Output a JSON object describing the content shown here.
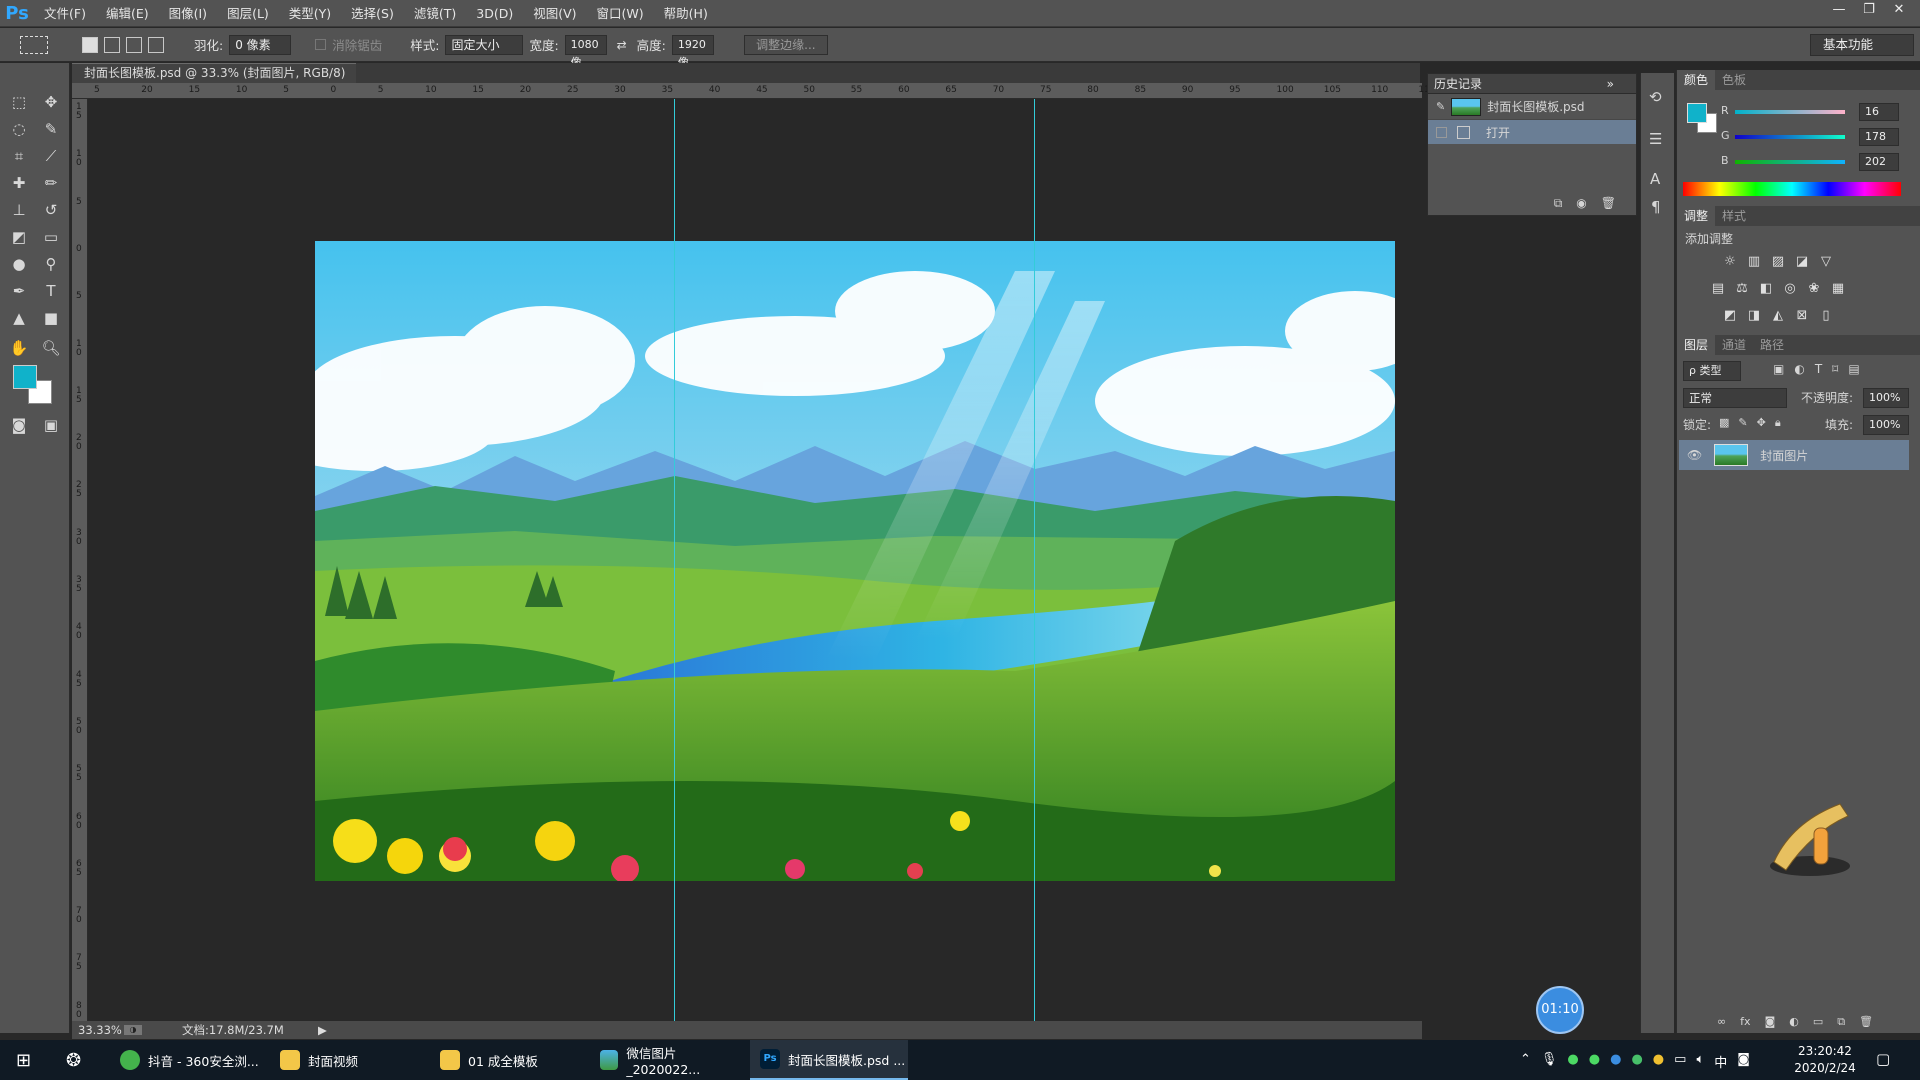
{
  "app": {
    "logo": "Ps"
  },
  "menu": [
    "文件(F)",
    "编辑(E)",
    "图像(I)",
    "图层(L)",
    "类型(Y)",
    "选择(S)",
    "滤镜(T)",
    "3D(D)",
    "视图(V)",
    "窗口(W)",
    "帮助(H)"
  ],
  "window_controls": {
    "minimize": "—",
    "restore": "❐",
    "close": "✕"
  },
  "options": {
    "feather_label": "羽化:",
    "feather_value": "0 像素",
    "antialias_label": "消除锯齿",
    "style_label": "样式:",
    "style_value": "固定大小",
    "width_label": "宽度:",
    "width_value": "1080 像",
    "height_label": "高度:",
    "height_value": "1920 像",
    "refine_edge": "调整边缘...",
    "workspace": "基本功能"
  },
  "document": {
    "tab_title": "封面长图模板.psd @ 33.3% (封面图片, RGB/8)",
    "tab_close": "×",
    "zoom": "33.33%",
    "doc_size": "文档:17.8M/23.7M"
  },
  "ruler": {
    "h_ticks": [
      "5",
      "20",
      "15",
      "10",
      "5",
      "0",
      "5",
      "10",
      "15",
      "20",
      "25",
      "30",
      "35",
      "40",
      "45",
      "50",
      "55",
      "60",
      "65",
      "70",
      "75",
      "80",
      "85",
      "90",
      "95",
      "100",
      "105",
      "110",
      "115"
    ],
    "v_ticks": [
      "1\n5",
      "1\n0",
      "5",
      "0",
      "5",
      "1\n0",
      "1\n5",
      "2\n0",
      "2\n5",
      "3\n0",
      "3\n5",
      "4\n0",
      "4\n5",
      "5\n0",
      "5\n5",
      "6\n0",
      "6\n5",
      "7\n0",
      "7\n5",
      "8\n0"
    ]
  },
  "history": {
    "title": "历史记录",
    "snapshot": "封面长图模板.psd",
    "step": "打开"
  },
  "color": {
    "tabs": [
      "颜色",
      "色板"
    ],
    "r_label": "R",
    "r_value": "16",
    "g_label": "G",
    "g_value": "178",
    "b_label": "B",
    "b_value": "202",
    "foreground": "#10b2ca",
    "background": "#ffffff"
  },
  "adjustments": {
    "tabs": [
      "调整",
      "样式"
    ],
    "add_label": "添加调整"
  },
  "layers": {
    "tabs": [
      "图层",
      "通道",
      "路径"
    ],
    "filter_kind": "ρ 类型",
    "blend_mode": "正常",
    "opacity_label": "不透明度:",
    "opacity_value": "100%",
    "lock_label": "锁定:",
    "fill_label": "填充:",
    "fill_value": "100%",
    "layer_name": "封面图片"
  },
  "recording_timer": "01:10",
  "taskbar": {
    "items": [
      "抖音 - 360安全浏...",
      "封面视频",
      "01 成全模板",
      "微信图片_2020022...",
      "封面长图模板.psd ..."
    ],
    "time": "23:20:42",
    "date": "2020/2/24",
    "ime": "中"
  }
}
